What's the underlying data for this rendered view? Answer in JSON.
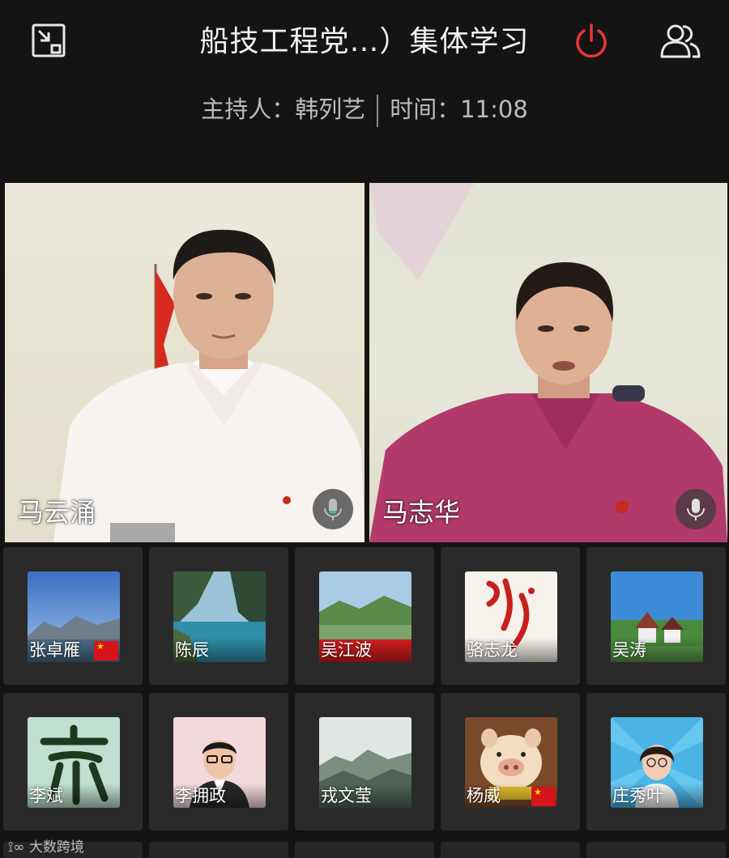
{
  "header": {
    "title": "船技工程党…）集体学习",
    "host_label": "主持人：韩列艺",
    "time_label": "时间：11:08",
    "icons": [
      "exit-fullscreen-icon",
      "power-icon",
      "participants-icon"
    ],
    "power_color": "#e53935"
  },
  "main_videos": [
    {
      "name": "马云涌",
      "mic_icon": "microphone-icon"
    },
    {
      "name": "马志华",
      "mic_icon": "microphone-icon"
    }
  ],
  "participants": [
    {
      "name": "张卓雁",
      "thumb": "mountain-lake",
      "flag": true
    },
    {
      "name": "陈辰",
      "thumb": "valley-lake",
      "flag": false
    },
    {
      "name": "吴江波",
      "thumb": "green-hills-banner",
      "flag": false
    },
    {
      "name": "骆志龙",
      "thumb": "calligraphy-red",
      "flag": false
    },
    {
      "name": "吴涛",
      "thumb": "village",
      "flag": false
    },
    {
      "name": "李斌",
      "thumb": "calligraphy-jia",
      "flag": false
    },
    {
      "name": "李拥政",
      "thumb": "cartoon-man",
      "flag": false
    },
    {
      "name": "戎文莹",
      "thumb": "misty-mountains",
      "flag": false
    },
    {
      "name": "杨威",
      "thumb": "cartoon-pig",
      "flag": true
    },
    {
      "name": "庄秀叶",
      "thumb": "girl-portrait",
      "flag": false
    }
  ],
  "watermark": "大数跨境",
  "watermark_icon": "brand-logo-icon"
}
